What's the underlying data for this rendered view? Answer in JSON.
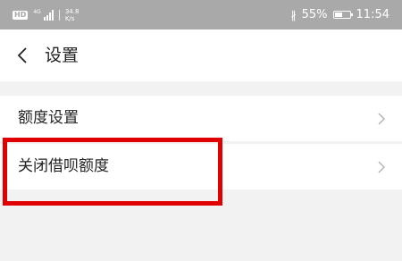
{
  "status_bar": {
    "hd_badge": "HD",
    "signal_label": "4G",
    "net_speed_value": "34.8",
    "net_speed_unit": "K/s",
    "battery_percent": "55%",
    "time": "11:54"
  },
  "header": {
    "title": "设置"
  },
  "list": {
    "items": [
      {
        "label": "额度设置"
      },
      {
        "label": "关闭借呗额度"
      }
    ]
  },
  "colors": {
    "status_bar_bg": "#a9a9a9",
    "highlight": "#e00000",
    "page_bg": "#f2f2f2"
  },
  "icons": {
    "back": "chevron-left-icon",
    "row_arrow": "chevron-right-icon",
    "bluetooth": "bluetooth-icon",
    "battery": "battery-icon",
    "signal": "signal-icon"
  },
  "battery_level": 0.55
}
